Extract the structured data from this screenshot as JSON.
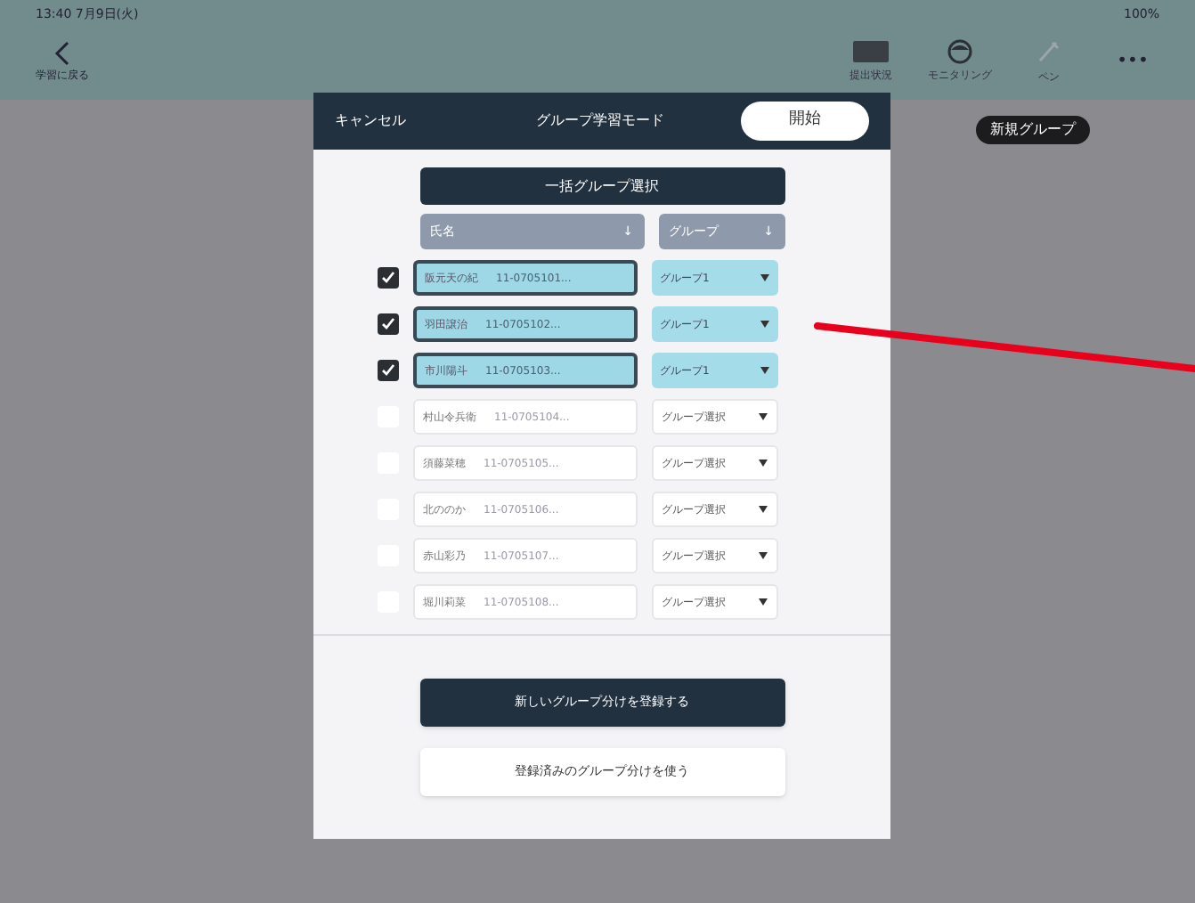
{
  "status_bar": {
    "time": "13:40 7月9日(火)",
    "battery": "100%"
  },
  "nav": {
    "back_label": "学習に戻る",
    "tools": [
      {
        "label": "提出状況",
        "kind": "board"
      },
      {
        "label": "モニタリング",
        "kind": "face"
      },
      {
        "label": "ペン",
        "kind": "pen"
      }
    ],
    "more": "•••"
  },
  "badge": "新規グループ",
  "modal": {
    "cancel": "キャンセル",
    "title": "グループ学習モード",
    "start": "開始",
    "bulk_button": "一括グループ選択",
    "columns": [
      {
        "label": "氏名",
        "sort": "↓"
      },
      {
        "label": "グループ",
        "sort": "↓"
      }
    ],
    "rows": [
      {
        "checked": true,
        "name": "阪元天の紀",
        "id": "11-0705101...",
        "group": "グループ1"
      },
      {
        "checked": true,
        "name": "羽田譲治",
        "id": "11-0705102...",
        "group": "グループ1"
      },
      {
        "checked": true,
        "name": "市川陽斗",
        "id": "11-0705103...",
        "group": "グループ1"
      },
      {
        "checked": false,
        "name": "村山令兵衛",
        "id": "11-0705104...",
        "group": "グループ選択"
      },
      {
        "checked": false,
        "name": "須藤菜穂",
        "id": "11-0705105...",
        "group": "グループ選択"
      },
      {
        "checked": false,
        "name": "北ののか",
        "id": "11-0705106...",
        "group": "グループ選択"
      },
      {
        "checked": false,
        "name": "赤山彩乃",
        "id": "11-0705107...",
        "group": "グループ選択"
      },
      {
        "checked": false,
        "name": "堀川莉菜",
        "id": "11-0705108...",
        "group": "グループ選択"
      }
    ],
    "new_button": "新しいグループ分けを登録する",
    "saved_button": "登録済みのグループ分けを使う"
  }
}
